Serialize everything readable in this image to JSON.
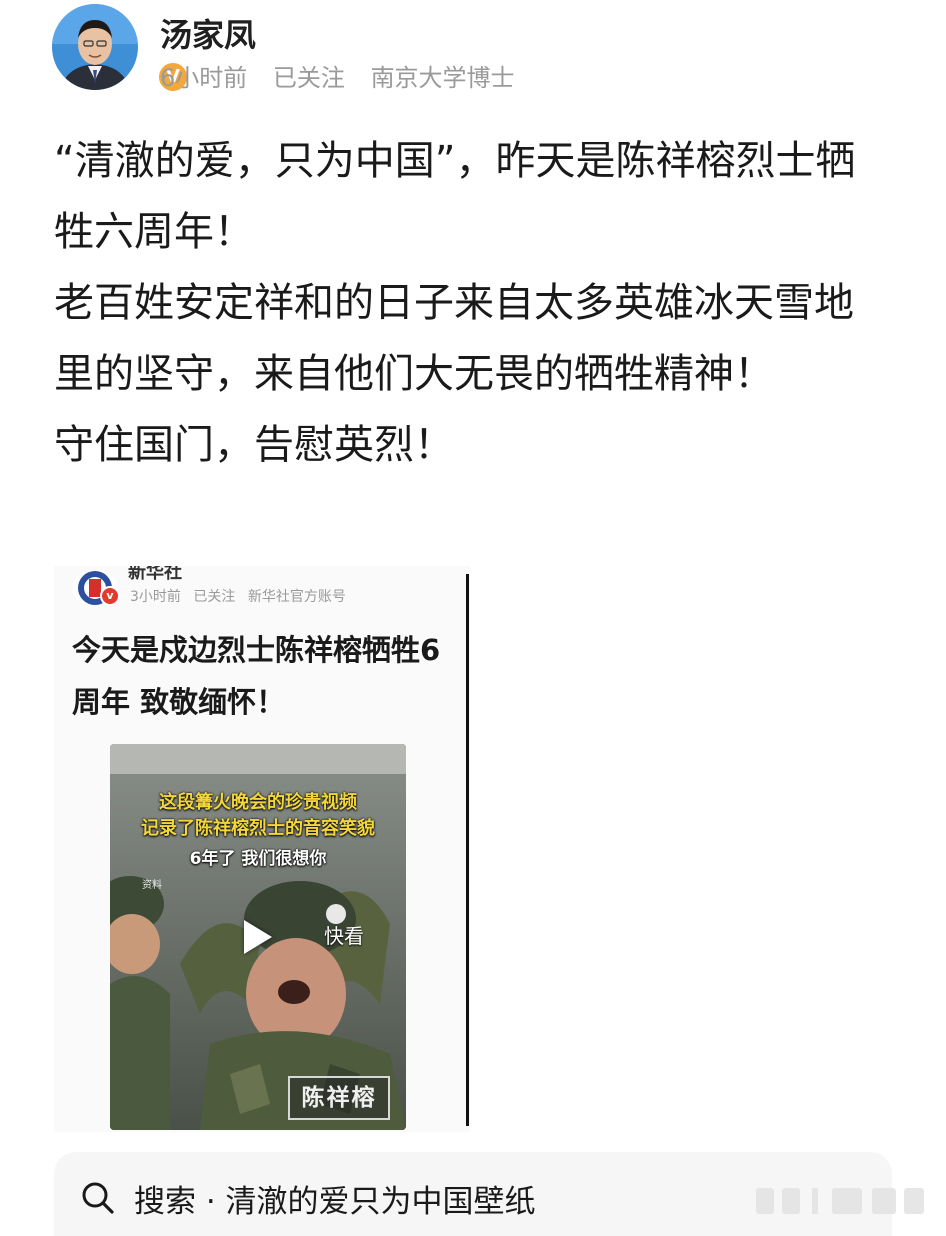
{
  "post": {
    "author": "汤家凤",
    "verified_badge": "V",
    "meta": {
      "time": "6小时前",
      "follow_status": "已关注",
      "description": "南京大学博士"
    },
    "paragraphs": [
      "“清澈的爱，只为中国”，昨天是陈祥榕烈士牺牲六周年！",
      "老百姓安定祥和的日子来自太多英雄冰天雪地里的坚守，来自他们大无畏的牺牲精神！",
      "守住国门，告慰英烈！"
    ]
  },
  "embedded": {
    "source_name": "新华社",
    "verified_badge": "v",
    "meta": {
      "time": "3小时前",
      "follow_status": "已关注",
      "description": "新华社官方账号"
    },
    "title": "今天是戍边烈士陈祥榕牺牲6周年 致敬缅怀！",
    "video": {
      "caption_line1": "这段篝火晚会的珍贵视频",
      "caption_line2": "记录了陈祥榕烈士的音容笑貌",
      "caption_line3": "6年了 我们很想你",
      "small_label": "资料",
      "quick_watch": "快看",
      "name_stamp": "陈祥榕"
    }
  },
  "search_bar": {
    "label": "搜索 · 清澈的爱只为中国壁纸"
  },
  "colors": {
    "meta_gray": "#9a9a9a",
    "verified_orange": "#f2a83a",
    "caption_yellow": "#f3d63a",
    "search_bg": "#f6f6f7"
  }
}
